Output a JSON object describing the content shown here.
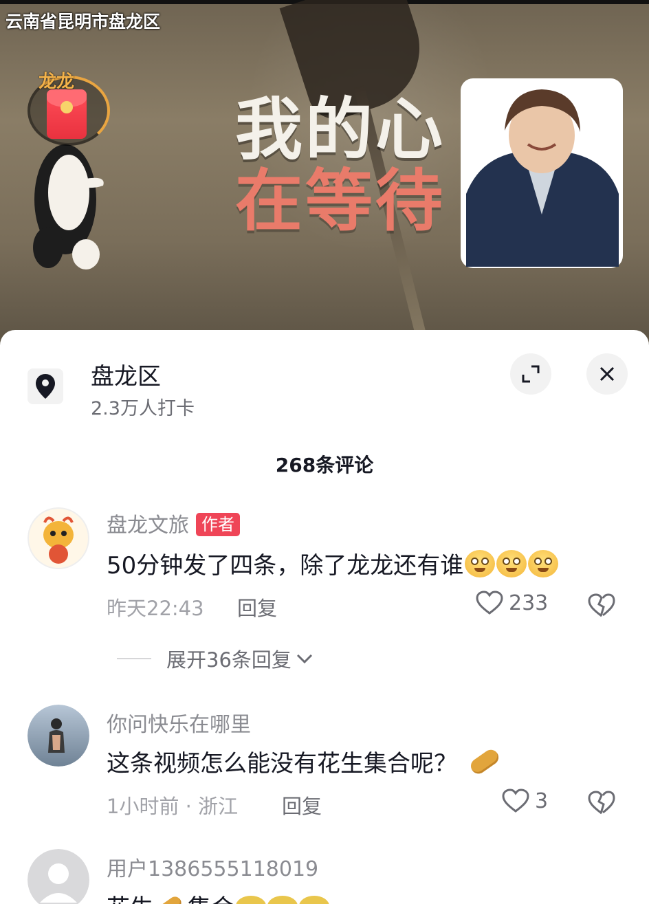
{
  "video": {
    "location_overlay": "云南省昆明市盘龙区",
    "caption_line1": "我的心",
    "caption_line2": "在等待",
    "red_packet_label": "龙龙"
  },
  "location_card": {
    "title": "盘龙区",
    "subtitle": "2.3万人打卡",
    "icon": "map-pin-icon"
  },
  "header_buttons": {
    "expand_icon": "expand-icon",
    "close_icon": "close-icon"
  },
  "comments_header": {
    "count_text": "268条评论"
  },
  "comments": [
    {
      "username": "盘龙文旅",
      "badge": "作者",
      "text": "50分钟发了四条，除了龙龙还有谁",
      "time": "昨天22:43",
      "reply_label": "回复",
      "likes": "233",
      "expand_replies": "展开36条回复"
    },
    {
      "username": "你问快乐在哪里",
      "text": "这条视频怎么能没有花生集合呢？",
      "time": "1小时前 · 浙江",
      "reply_label": "回复",
      "likes": "3"
    },
    {
      "username": "用户1386555118019",
      "text_part1": "花生",
      "text_part2": "集合"
    }
  ],
  "colors": {
    "author_badge": "#ef4557",
    "primary_text": "#161823",
    "secondary_text": "#8a8b91",
    "panel_bg": "#ffffff"
  }
}
